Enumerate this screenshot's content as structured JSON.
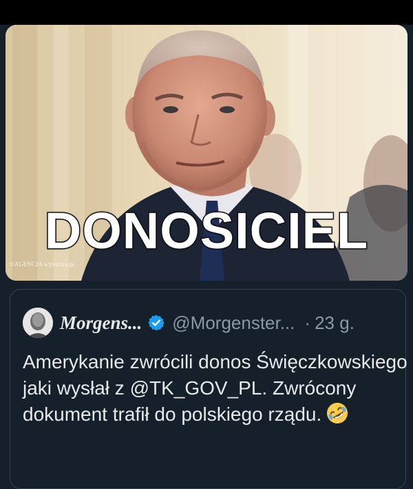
{
  "media": {
    "overlay_text": "DONOSICIEL",
    "watermark": "©AGENCJA wyborcza.pl"
  },
  "quote": {
    "display_name": "Morgens...",
    "handle": "@Morgenster...",
    "separator": "·",
    "time": "23 g.",
    "text": "Amerykanie zwrócili donos Święczkowskiego jaki wysłał z @TK_GOV_PL. Zwrócony dokument trafił do polskiego rządu.",
    "emoji": "rolling-on-floor-laughing-icon"
  },
  "colors": {
    "background": "#15202b",
    "border": "#38444d",
    "verified": "#1d9bf0",
    "muted_text": "#8b98a5"
  }
}
